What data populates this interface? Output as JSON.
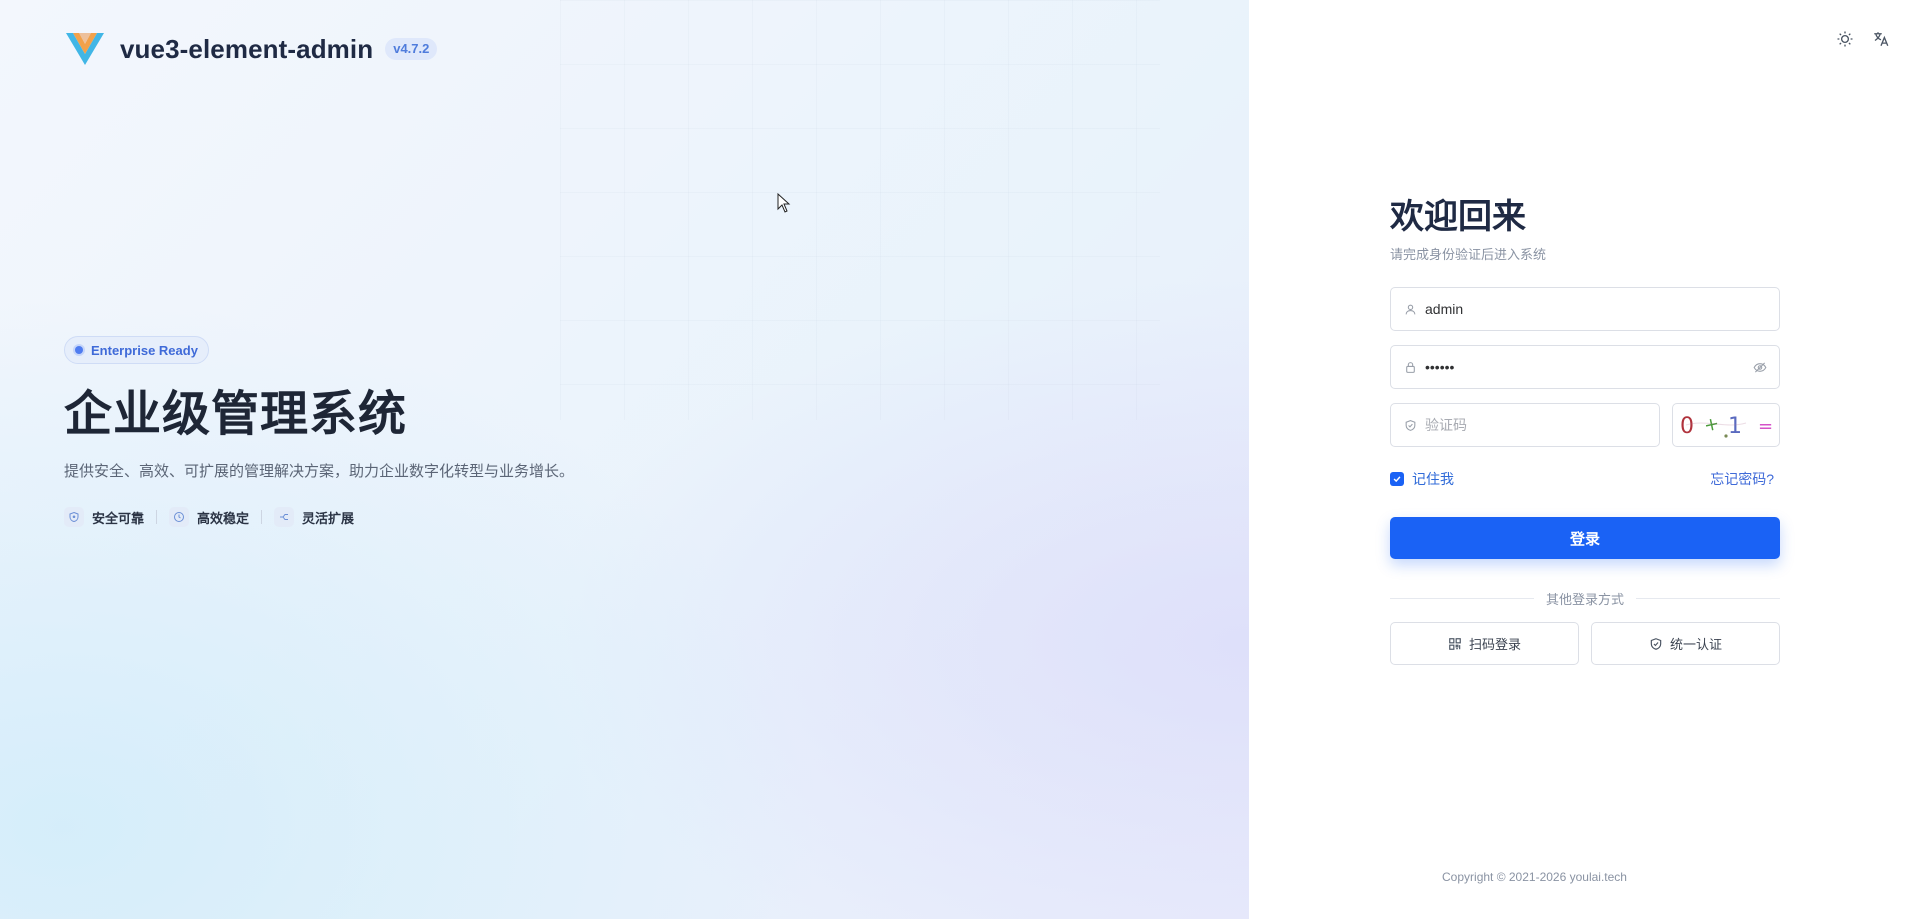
{
  "brand": {
    "name": "vue3-element-admin",
    "version": "v4.7.2",
    "logo_icon": "vue-v-logo-icon"
  },
  "hero": {
    "tag": "Enterprise Ready",
    "title": "企业级管理系统",
    "description": "提供安全、高效、可扩展的管理解决方案，助力企业数字化转型与业务增长。",
    "features": [
      {
        "label": "安全可靠",
        "icon": "shield-icon"
      },
      {
        "label": "高效稳定",
        "icon": "clock-icon"
      },
      {
        "label": "灵活扩展",
        "icon": "branch-icon"
      }
    ]
  },
  "tools": {
    "theme_icon": "sun-icon",
    "language_icon": "translate-icon"
  },
  "login": {
    "welcome": "欢迎回来",
    "subtitle": "请完成身份验证后进入系统",
    "username": {
      "value": "admin",
      "icon": "user-icon"
    },
    "password": {
      "value": "123456",
      "icon": "lock-icon",
      "toggle_icon": "eye-off-icon"
    },
    "captcha": {
      "placeholder": "验证码",
      "icon": "shield-check-icon",
      "image_text": "0 + 1 ="
    },
    "remember_me": {
      "label": "记住我",
      "checked": true
    },
    "forgot_password": "忘记密码?",
    "submit": "登录",
    "other_methods": "其他登录方式",
    "alt_methods": [
      {
        "label": "扫码登录",
        "icon": "qrcode-icon"
      },
      {
        "label": "统一认证",
        "icon": "shield-check-icon"
      }
    ]
  },
  "footer": {
    "copyright": "Copyright © 2021-2026 youlai.tech"
  },
  "colors": {
    "primary": "#1a62f5",
    "title": "#1f2a44",
    "accent_tag": "#3f6ad8"
  }
}
